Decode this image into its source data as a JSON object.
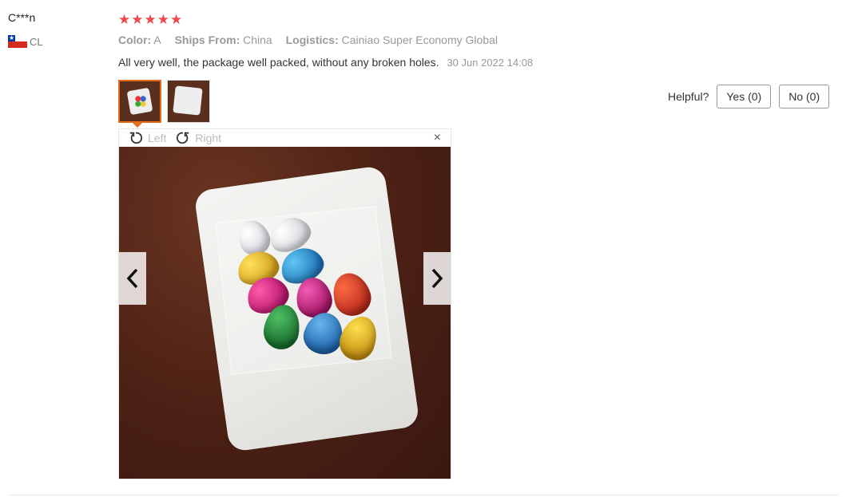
{
  "review": {
    "user": {
      "name": "C***n",
      "country_code": "CL"
    },
    "stars": [
      "★",
      "★",
      "★",
      "★",
      "★"
    ],
    "meta": {
      "color_label": "Color:",
      "color_value": "A",
      "ships_label": "Ships From:",
      "ships_value": "China",
      "logistics_label": "Logistics:",
      "logistics_value": "Cainiao Super Economy Global"
    },
    "text": "All very well, the package well packed, without any broken holes.",
    "date": "30 Jun 2022 14:08",
    "helpful": {
      "label": "Helpful?",
      "yes": "Yes (0)",
      "no": "No (0)"
    },
    "viewer": {
      "rotate_left": "Left",
      "rotate_right": "Right",
      "close": "×"
    }
  },
  "colors": {
    "accent": "#e86b1c",
    "star": "#f04848"
  }
}
